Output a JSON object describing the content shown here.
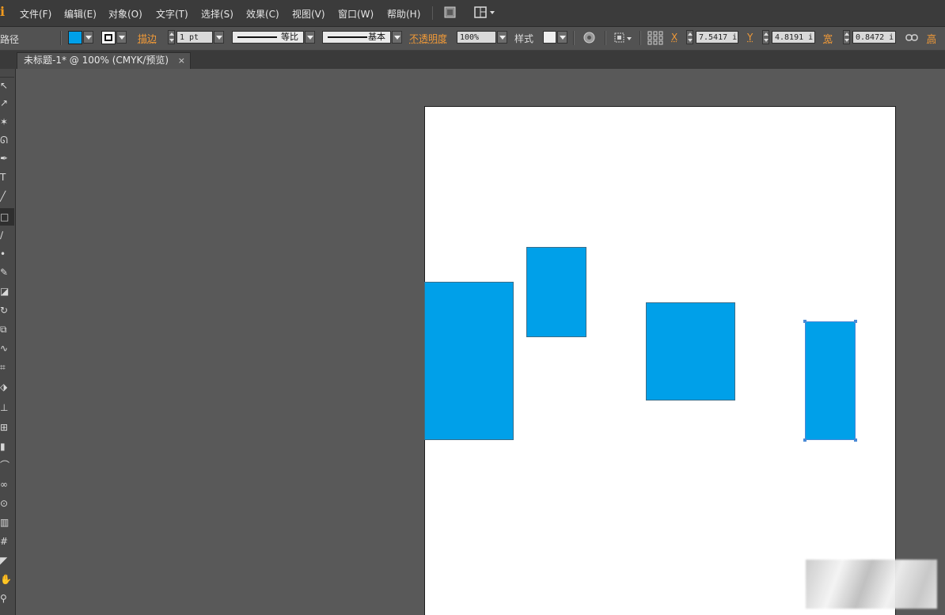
{
  "app": {
    "logo_text": "i",
    "accent_color": "#f29a1e"
  },
  "menu": {
    "items": [
      "文件(F)",
      "编辑(E)",
      "对象(O)",
      "文字(T)",
      "选择(S)",
      "效果(C)",
      "视图(V)",
      "窗口(W)",
      "帮助(H)"
    ],
    "bridge_icon": "bridge-icon",
    "arrange_icon": "arrange-documents-icon"
  },
  "control": {
    "selection_label": "路径",
    "fill_color": "#00a0e9",
    "stroke_label": "描边",
    "stroke_weight": "1 pt",
    "profile_label": "等比",
    "brush_label": "基本",
    "opacity_label": "不透明度",
    "opacity_value": "100%",
    "style_label": "样式",
    "x_label": "X",
    "x_value": "7.5417 i",
    "y_label": "Y",
    "y_value": "4.8191 i",
    "w_label": "宽",
    "w_value": "0.8472 i",
    "h_label": "高"
  },
  "tab": {
    "title": "未标题-1* @ 100% (CMYK/预览)",
    "close": "×"
  },
  "artwork": {
    "shape_fill": "#00a0e9",
    "artboard_color": "#ffffff"
  }
}
